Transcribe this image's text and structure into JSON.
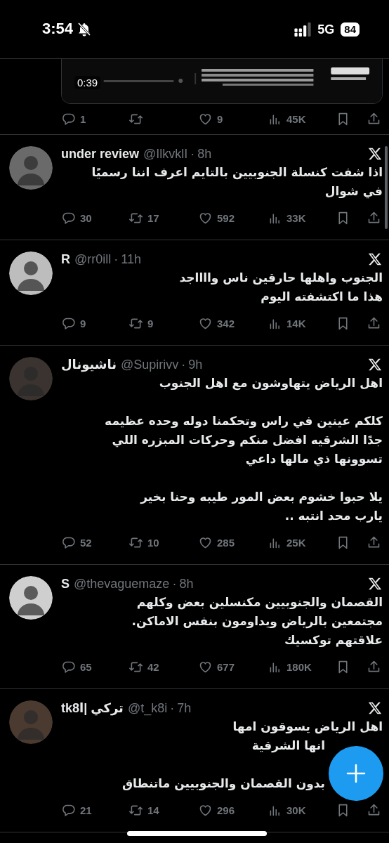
{
  "status_bar": {
    "time": "3:54",
    "network": "5G",
    "battery": "84"
  },
  "separator": "·",
  "top_post": {
    "media": {
      "kind": "picture",
      "duration": "0:39"
    },
    "actions": {
      "reply": "1",
      "like": "9",
      "views": "45K"
    }
  },
  "posts": [
    {
      "name": "under review",
      "handle": "@IlkvklI",
      "time": "8h",
      "paragraphs": [
        [
          "اذا شفت كنسلة الجنوبيين بالتايم اعرف اننا رسميًا",
          "في شوال"
        ]
      ],
      "actions": {
        "reply": "30",
        "retweet": "17",
        "like": "592",
        "views": "33K"
      }
    },
    {
      "name": "R",
      "handle": "@rr0ill",
      "time": "11h",
      "paragraphs": [
        [
          "الجنوب واهلها حارقين ناس وااااجد",
          "هذا ما اكتشفته اليوم"
        ]
      ],
      "actions": {
        "reply": "9",
        "retweet": "9",
        "like": "342",
        "views": "14K"
      }
    },
    {
      "name": "ناشيونال",
      "handle": "@Supirivv",
      "time": "9h",
      "paragraphs": [
        [
          "اهل الرياض يتهاوشون مع اهل الجنوب"
        ],
        [
          "كلكم عينين في راس وتحكمنا دوله وحده عظيمه",
          "جدًا  الشرقيه افضل منكم وحركات المبزره اللي",
          "تسوونها ذي مالها داعي"
        ],
        [
          "يلا حبوا خشوم بعض المور طيبه وحنا بخير",
          "يارب محد انتبه .."
        ]
      ],
      "actions": {
        "reply": "52",
        "retweet": "10",
        "like": "285",
        "views": "25K"
      }
    },
    {
      "name": "S",
      "handle": "@thevaguemaze",
      "time": "8h",
      "paragraphs": [
        [
          "القصمان والجنوبيين مكنسلين بعض وكلهم",
          "مجتمعين بالرياض ويداومون بنفس الاماكن.",
          "علاقتهم توكسيك"
        ]
      ],
      "actions": {
        "reply": "65",
        "retweet": "42",
        "like": "677",
        "views": "180K"
      }
    },
    {
      "name": "tk8ا|‎ تركي",
      "handle": "@t_k8i",
      "time": "7h",
      "paragraphs": [
        [
          "اهل الرياض يسوقون امها",
          {
            "text": "انها الشرقية",
            "covered": true
          }
        ],
        [
          {
            "text": "بدون القصمان والجنوبيين ماتنطاق",
            "covered": true
          }
        ]
      ],
      "actions": {
        "reply": "21",
        "retweet": "14",
        "like": "296",
        "views": "30K"
      }
    }
  ],
  "compose_button": {
    "kind": "fab"
  }
}
